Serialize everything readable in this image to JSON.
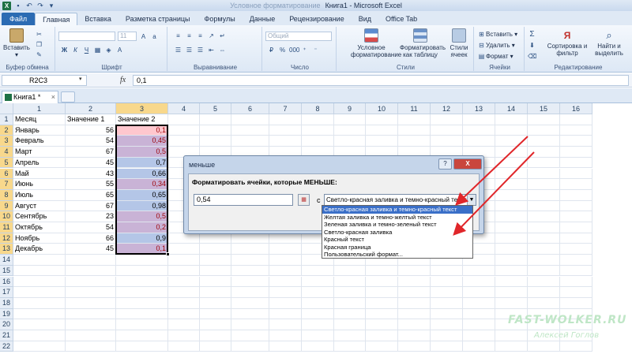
{
  "window": {
    "title": "Книга1 - Microsoft Excel",
    "title_prefix_blurred": "Условное форматирование"
  },
  "ribbon_tabs": [
    "Файл",
    "Главная",
    "Вставка",
    "Разметка страницы",
    "Формулы",
    "Данные",
    "Рецензирование",
    "Вид",
    "Office Tab"
  ],
  "ribbon": {
    "paste_label": "Вставить",
    "clipboard_label": "Буфер обмена",
    "font_name": "",
    "font_size": "11",
    "font_label": "Шрифт",
    "align_label": "Выравнивание",
    "number_format": "Общий",
    "number_label": "Число",
    "cond_format": "Условное форматирование",
    "format_table": "Форматировать как таблицу",
    "cell_styles": "Стили ячеек",
    "styles_label": "Стили",
    "insert": "Вставить",
    "delete": "Удалить",
    "format": "Формат",
    "cells_label": "Ячейки",
    "sort_filter": "Сортировка и фильтр",
    "find_select": "Найти и выделить",
    "editing_label": "Редактирование"
  },
  "formula_bar": {
    "name_box": "R2C3",
    "fx": "fx",
    "value": "0,1"
  },
  "workbook_tab": {
    "name": "Книга1 *",
    "close": "×"
  },
  "sheet": {
    "col_headers": [
      "1",
      "2",
      "3",
      "4",
      "5",
      "6",
      "7",
      "8",
      "9",
      "10",
      "11",
      "12",
      "13",
      "14",
      "15",
      "16"
    ],
    "row_headers": [
      "1",
      "2",
      "3",
      "4",
      "5",
      "6",
      "7",
      "8",
      "9",
      "10",
      "11",
      "12",
      "13",
      "14",
      "15",
      "16",
      "17",
      "18",
      "19",
      "20",
      "21",
      "22"
    ],
    "header_row": [
      "Месяц",
      "Значение 1",
      "Значение 2"
    ],
    "rows": [
      [
        "Январь",
        "56",
        "0,1"
      ],
      [
        "Февраль",
        "54",
        "0,45"
      ],
      [
        "Март",
        "67",
        "0,5"
      ],
      [
        "Апрель",
        "45",
        "0,7"
      ],
      [
        "Май",
        "43",
        "0,66"
      ],
      [
        "Июнь",
        "55",
        "0,34"
      ],
      [
        "Июль",
        "65",
        "0,65"
      ],
      [
        "Август",
        "67",
        "0,98"
      ],
      [
        "Сентябрь",
        "23",
        "0,5"
      ],
      [
        "Октябрь",
        "54",
        "0,2"
      ],
      [
        "Ноябрь",
        "66",
        "0,9"
      ],
      [
        "Декабрь",
        "45",
        "0,1"
      ]
    ],
    "highlighted_rows": [
      true,
      true,
      true,
      false,
      false,
      true,
      false,
      false,
      true,
      true,
      false,
      true
    ]
  },
  "colors": {
    "highlight_fill": "#ffc7ce",
    "highlight_text": "#9c0006",
    "selection_fill": "#aeb9e0",
    "selected_header": "#f8d88c",
    "arrow_red": "#e0262a"
  },
  "dialog": {
    "title": "меньше",
    "help": "?",
    "close": "X",
    "prompt": "Форматировать ячейки, которые МЕНЬШЕ:",
    "value": "0,54",
    "with_label": "с",
    "format_selected": "Светло-красная заливка и темно-красный текст",
    "options": [
      "Светло-красная заливка и темно-красный текст",
      "Желтая заливка и темно-желтый текст",
      "Зеленая заливка и темно-зеленый текст",
      "Светло-красная заливка",
      "Красный текст",
      "Красная граница",
      "Пользовательский формат..."
    ]
  },
  "watermark": {
    "site": "FAST-WOLKER.RU",
    "author": "Алексей Гоглов"
  }
}
